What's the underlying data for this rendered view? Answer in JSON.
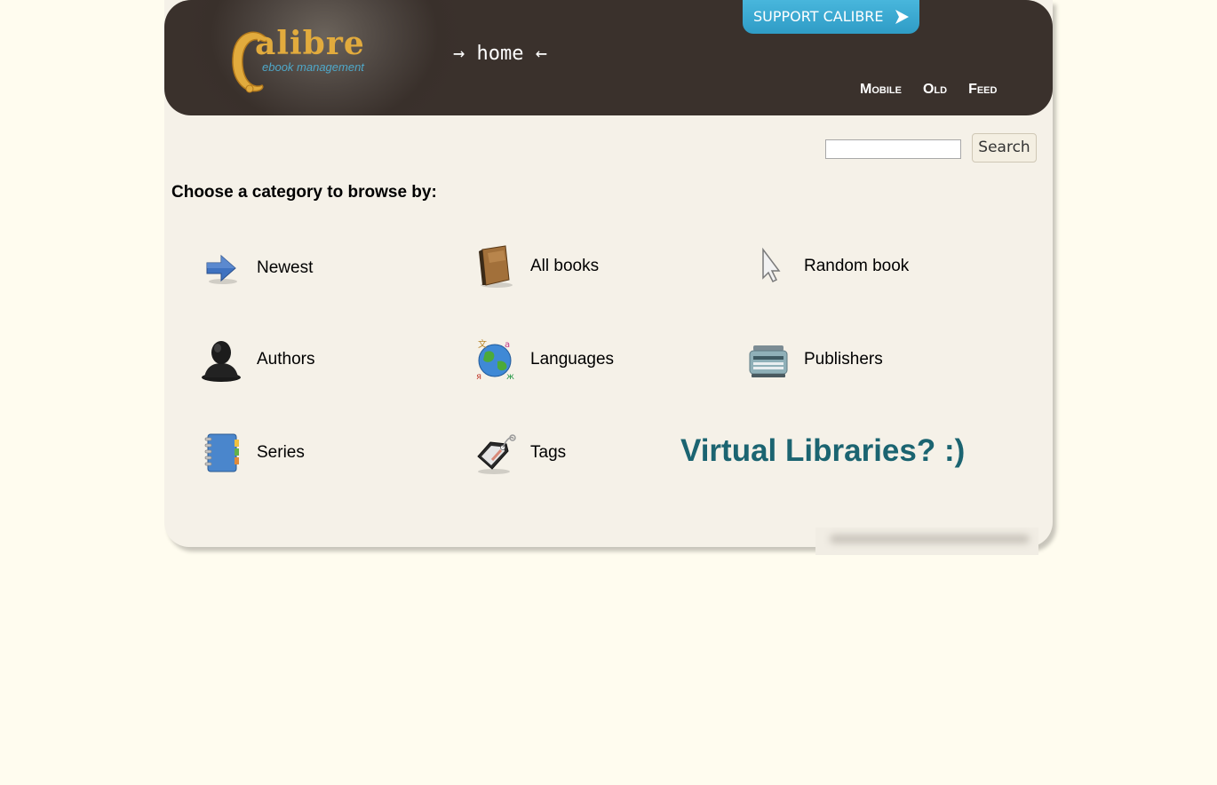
{
  "header": {
    "logo_word": "alibre",
    "logo_sub": "ebook management",
    "title": "→ home ←",
    "support_label": "SUPPORT CALIBRE",
    "nav": [
      "Mobile",
      "Old",
      "Feed"
    ]
  },
  "search": {
    "value": "",
    "button_label": "Search"
  },
  "main": {
    "heading": "Choose a category to browse by:",
    "categories": [
      {
        "label": "Newest",
        "icon": "arrow-right-icon"
      },
      {
        "label": "All books",
        "icon": "book-icon"
      },
      {
        "label": "Random book",
        "icon": "cursor-icon"
      },
      {
        "label": "Authors",
        "icon": "person-icon"
      },
      {
        "label": "Languages",
        "icon": "globe-icon"
      },
      {
        "label": "Publishers",
        "icon": "typewriter-icon"
      },
      {
        "label": "Series",
        "icon": "notebook-icon"
      },
      {
        "label": "Tags",
        "icon": "tag-icon"
      }
    ],
    "virtual_libraries": "Virtual Libraries? :)"
  },
  "colors": {
    "page_bg": "#fffcef",
    "panel_bg": "#f5f1e8",
    "header_bg": "#3a312c",
    "support_bg": "#3aa8d1",
    "virtual_text": "#1b6471",
    "logo_gold": "#e2ab3d",
    "logo_blue": "#4fa8c9"
  }
}
